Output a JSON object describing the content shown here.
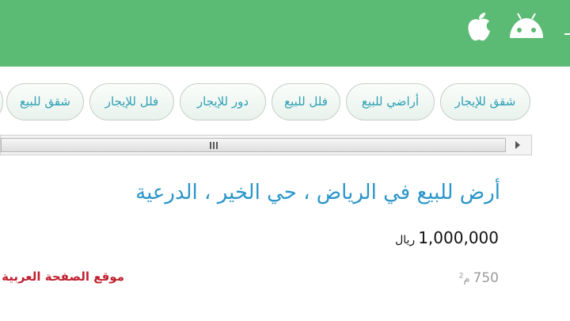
{
  "header": {
    "background_color": "#5bbb74",
    "icons": [
      "apple-icon",
      "android-icon",
      "menu-icon"
    ]
  },
  "category_chips": [
    "شقق للإيجار",
    "أراضي للبيع",
    "فلل للبيع",
    "دور للإيجار",
    "فلل للإيجار",
    "شقق للبيع"
  ],
  "listing": {
    "title": "أرض للبيع في الرياض ، حي الخير ، الدرعية",
    "price": "1,000,000",
    "currency": "ريال",
    "area": "750",
    "area_unit": "م",
    "area_unit_power": "2"
  },
  "source": {
    "label": "موقع الصفحة العربية"
  },
  "colors": {
    "title": "#2b96c9",
    "chip_text": "#2da0b3",
    "source": "#c0202e",
    "area": "#9a9a9a"
  }
}
